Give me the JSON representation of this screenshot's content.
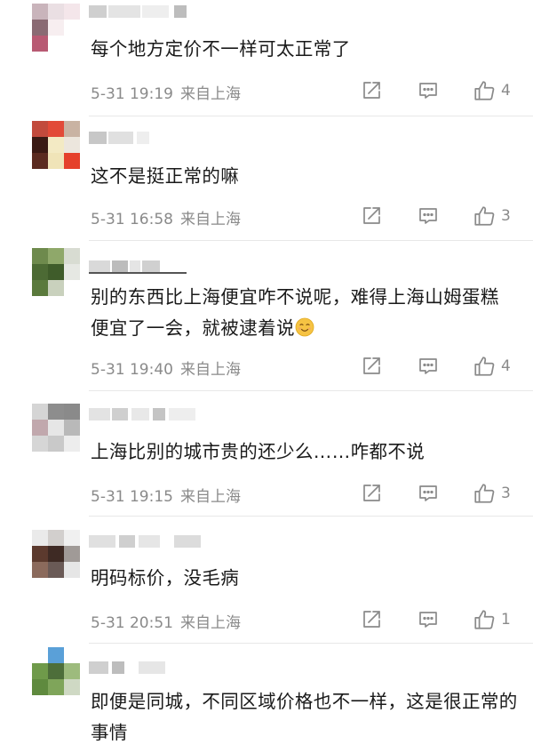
{
  "comments": [
    {
      "text": "每个地方定价不一样可太正常了",
      "date": "5-31 19:19",
      "location": "来自上海",
      "likes": "4"
    },
    {
      "text": "这不是挺正常的嘛",
      "date": "5-31 16:58",
      "location": "来自上海",
      "likes": "3"
    },
    {
      "text": "别的东西比上海便宜咋不说呢，难得上海山姆蛋糕便宜了一会，就被逮着说",
      "date": "5-31 19:40",
      "location": "来自上海",
      "likes": "4"
    },
    {
      "text": "上海比别的城市贵的还少么……咋都不说",
      "date": "5-31 19:15",
      "location": "来自上海",
      "likes": "3"
    },
    {
      "text": "明码标价，没毛病",
      "date": "5-31 20:51",
      "location": "来自上海",
      "likes": "1"
    },
    {
      "text": "即便是同城，不同区域价格也不一样，这是很正常的事情"
    }
  ],
  "icons": {
    "forward": "forward-icon",
    "reply": "comment-icon",
    "like": "thumbs-up-icon",
    "emoji": "smile-emoji-icon"
  },
  "colors": {
    "meta_text": "#8a8a8a",
    "icon": "#8a8a8a",
    "emoji": "#f6c343"
  }
}
